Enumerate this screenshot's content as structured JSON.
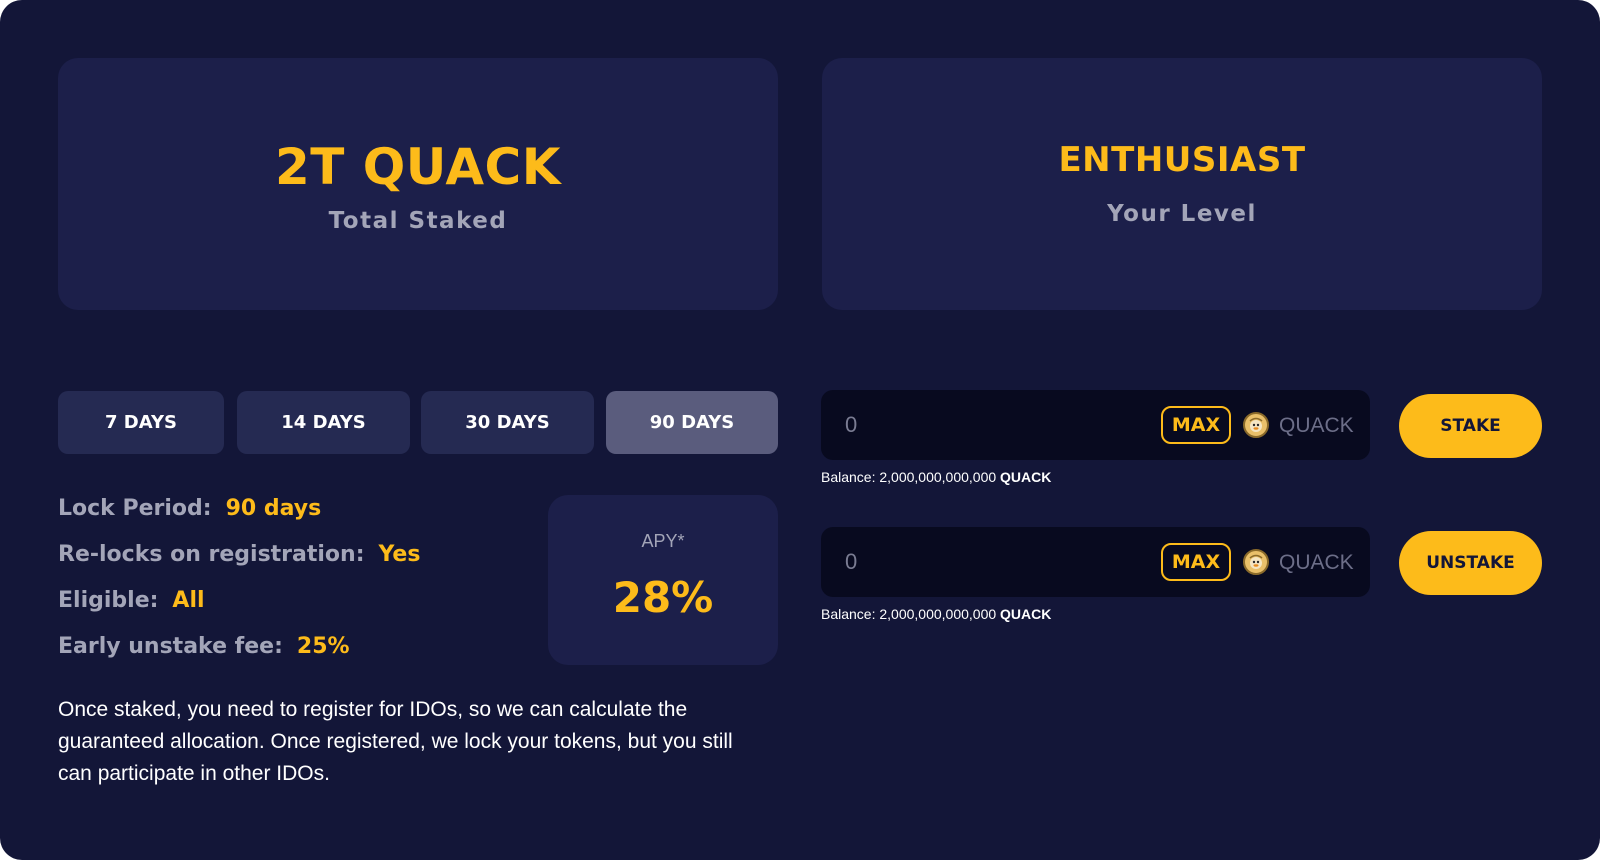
{
  "stats": {
    "total_staked_value": "2T QUACK",
    "total_staked_label": "Total Staked",
    "level_value": "ENTHUSIAST",
    "level_label": "Your Level"
  },
  "tabs": [
    {
      "label": "7 DAYS",
      "active": false
    },
    {
      "label": "14 DAYS",
      "active": false
    },
    {
      "label": "30 DAYS",
      "active": false
    },
    {
      "label": "90 DAYS",
      "active": true
    }
  ],
  "info": {
    "lock_period_label": "Lock Period:",
    "lock_period_value": "90 days",
    "relocks_label": "Re-locks on registration:",
    "relocks_value": "Yes",
    "eligible_label": "Eligible:",
    "eligible_value": "All",
    "fee_label": "Early unstake fee:",
    "fee_value": "25%"
  },
  "apy": {
    "label": "APY*",
    "value": "28%"
  },
  "description": "Once staked, you need to register for IDOs, so we can calculate the guaranteed allocation. Once registered, we lock your tokens, but you still can participate in other IDOs.",
  "stake": {
    "placeholder": "0",
    "max_label": "MAX",
    "token": "QUACK",
    "button_label": "STAKE",
    "balance_prefix": "Balance: 2,000,000,000,000",
    "balance_token": "QUACK"
  },
  "unstake": {
    "placeholder": "0",
    "max_label": "MAX",
    "token": "QUACK",
    "button_label": "UNSTAKE",
    "balance_prefix": "Balance: 2,000,000,000,000",
    "balance_token": "QUACK"
  },
  "colors": {
    "background": "#131638",
    "card": "#1c1f4a",
    "accent": "#fdbb1a",
    "muted_text": "#a3a5b8",
    "input_bg": "#080a1f"
  },
  "icons": {
    "token": "quack-duck-icon"
  }
}
